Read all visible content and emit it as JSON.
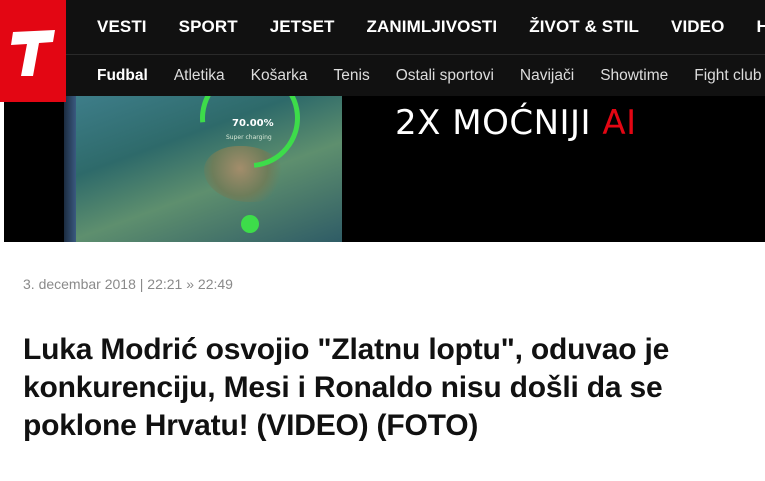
{
  "logo": {
    "text": "T"
  },
  "main_nav": [
    "VESTI",
    "SPORT",
    "JETSET",
    "ZANIMLJIVOSTI",
    "ŽIVOT & STIL",
    "VIDEO",
    "HI-TECH"
  ],
  "sub_nav": [
    "Fudbal",
    "Atletika",
    "Košarka",
    "Tenis",
    "Ostali sportovi",
    "Navijači",
    "Showtime",
    "Fight club"
  ],
  "banner": {
    "battery_percent": "70.00%",
    "battery_note": "Super charging",
    "slogan_main": "2X MOĆNIJI ",
    "slogan_accent": "AI",
    "accent_color": "#e30613"
  },
  "article": {
    "date": "3. decembar 2018",
    "separator": " | ",
    "time_published": "22:21",
    "arrow": " » ",
    "time_updated": "22:49",
    "title": "Luka Modrić osvojio \"Zlatnu loptu\", oduvao je konkurenciju, Mesi i Ronaldo nisu došli da se poklone Hrvatu! (VIDEO) (FOTO)"
  }
}
